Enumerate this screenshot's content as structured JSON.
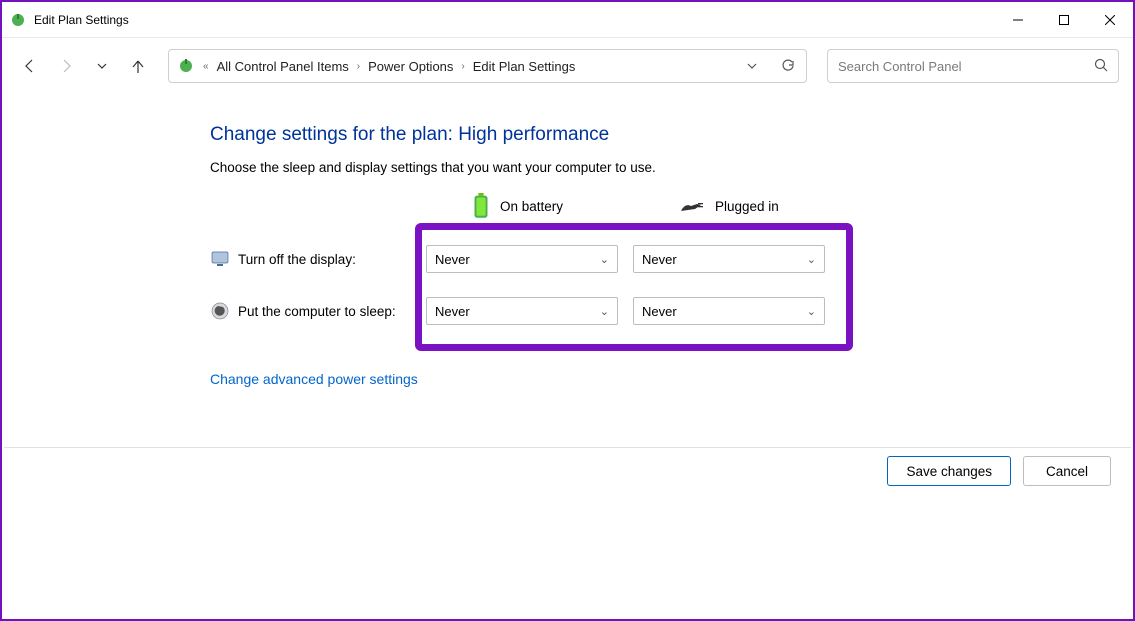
{
  "window": {
    "title": "Edit Plan Settings"
  },
  "breadcrumb": {
    "items": [
      "All Control Panel Items",
      "Power Options",
      "Edit Plan Settings"
    ]
  },
  "search": {
    "placeholder": "Search Control Panel"
  },
  "page": {
    "heading": "Change settings for the plan: High performance",
    "subtext": "Choose the sleep and display settings that you want your computer to use.",
    "columns": {
      "battery": "On battery",
      "plugged": "Plugged in"
    },
    "rows": {
      "display": {
        "label": "Turn off the display:",
        "battery": "Never",
        "plugged": "Never"
      },
      "sleep": {
        "label": "Put the computer to sleep:",
        "battery": "Never",
        "plugged": "Never"
      }
    },
    "advanced_link": "Change advanced power settings"
  },
  "buttons": {
    "save": "Save changes",
    "cancel": "Cancel"
  }
}
